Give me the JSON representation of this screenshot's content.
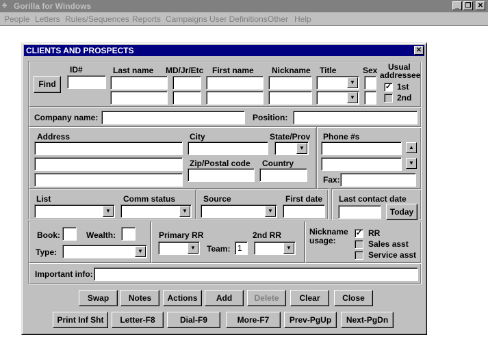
{
  "app": {
    "title": "Gorilla for Windows"
  },
  "menu": {
    "items": [
      "People",
      "Letters",
      "Rules/Sequences",
      "Reports",
      "Campaigns",
      "User Definitions",
      "Other",
      "Help"
    ]
  },
  "dialog": {
    "title": "CLIENTS AND PROSPECTS",
    "names": {
      "find_label": "Find",
      "id_label": "ID#",
      "last_name_label": "Last name",
      "suffix_label": "MD/Jr/Etc",
      "first_name_label": "First name",
      "nickname_label": "Nickname",
      "title_label": "Title",
      "sex_label": "Sex",
      "usual_label_1": "Usual",
      "usual_label_2": "addressee",
      "first_label": "1st",
      "second_label": "2nd",
      "first_checked": true,
      "second_checked": false
    },
    "company": {
      "company_label": "Company name:",
      "position_label": "Position:"
    },
    "address": {
      "address_label": "Address",
      "city_label": "City",
      "state_label": "State/Prov",
      "zip_label": "Zip/Postal code",
      "country_label": "Country",
      "phone_label": "Phone #s",
      "fax_label": "Fax:"
    },
    "list": {
      "list_label": "List",
      "comm_label": "Comm status",
      "source_label": "Source",
      "first_date_label": "First date",
      "last_contact_label": "Last contact date",
      "today_label": "Today"
    },
    "book": {
      "book_label": "Book:",
      "wealth_label": "Wealth:",
      "type_label": "Type:",
      "primary_rr_label": "Primary RR",
      "second_rr_label": "2nd RR",
      "team_label": "Team:",
      "team_value": "1",
      "nickname_usage_1": "Nickname",
      "nickname_usage_2": "usage:",
      "rr_label": "RR",
      "sales_label": "Sales asst",
      "service_label": "Service asst",
      "rr_checked": true,
      "sales_checked": false,
      "service_checked": false
    },
    "important_label": "Important info:",
    "buttons_row1": [
      "Swap",
      "Notes",
      "Actions",
      "Add",
      "Delete",
      "Clear",
      "Close"
    ],
    "buttons_row2": [
      "Print Inf Sht",
      "Letter-F8",
      "Dial-F9",
      "More-F7",
      "Prev-PgUp",
      "Next-PgDn"
    ]
  }
}
